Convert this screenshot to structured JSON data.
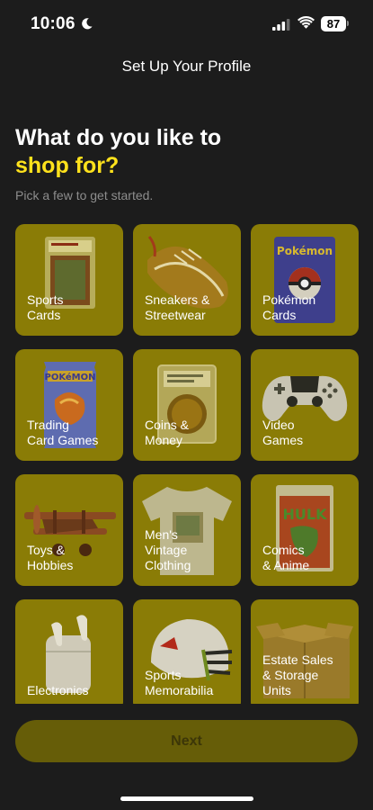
{
  "status": {
    "time": "10:06",
    "battery": "87"
  },
  "nav": {
    "title": "Set Up Your Profile"
  },
  "heading": {
    "line1": "What do you like to",
    "line2": "shop for?"
  },
  "subheading": "Pick a few to get started.",
  "categories": [
    {
      "label": "Sports\nCards",
      "icon": "graded-card"
    },
    {
      "label": "Sneakers &\nStreetwear",
      "icon": "sneaker"
    },
    {
      "label": "Pokémon\nCards",
      "icon": "pokemon-card"
    },
    {
      "label": "Trading\nCard Games",
      "icon": "card-pack"
    },
    {
      "label": "Coins &\nMoney",
      "icon": "graded-coin"
    },
    {
      "label": "Video\nGames",
      "icon": "game-controller"
    },
    {
      "label": "Toys &\nHobbies",
      "icon": "toy-airplane"
    },
    {
      "label": "Men's\nVintage\nClothing",
      "icon": "tshirt"
    },
    {
      "label": "Comics\n& Anime",
      "icon": "comic-book"
    },
    {
      "label": "Electronics",
      "icon": "earbuds"
    },
    {
      "label": "Sports\nMemorabilia",
      "icon": "football-helmet"
    },
    {
      "label": "Estate Sales\n& Storage\nUnits",
      "icon": "cardboard-box"
    }
  ],
  "next_button": {
    "label": "Next"
  },
  "colors": {
    "background": "#1c1c1c",
    "accent": "#ffe21c",
    "tile": "#8a7c06",
    "button": "#665d08"
  }
}
